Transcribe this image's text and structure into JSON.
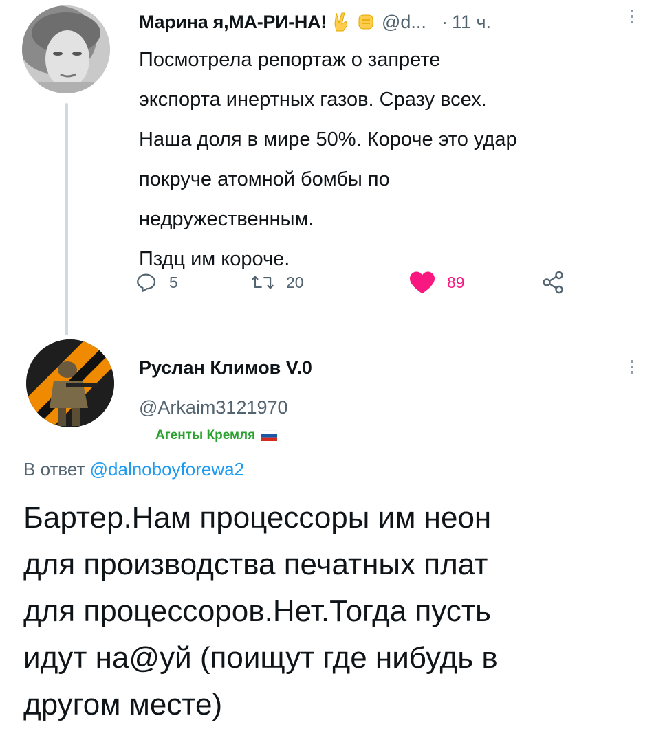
{
  "tweet1": {
    "author_name": "Марина я,МА-РИ-НА!",
    "emoji1": "victory-hand-emoji",
    "emoji2": "raised-fist-emoji",
    "handle": "@d...",
    "separator": "·",
    "time": "11 ч.",
    "body_lines": [
      "Посмотрела репортаж о запрете",
      "экспорта инертных газов. Сразу всех.",
      "Наша доля в мире 50%. Короче это удар",
      "покруче атомной бомбы по",
      "недружественным.",
      "Пздц им короче."
    ],
    "actions": {
      "reply_count": "5",
      "retweet_count": "20",
      "like_count": "89"
    },
    "liked": true
  },
  "tweet2": {
    "author_name": "Руслан Климов V.0",
    "handle": "@Arkaim3121970",
    "label": "Агенты Кремля",
    "reply_prefix": "В ответ",
    "reply_mention": "@dalnoboyforewa2",
    "body_lines": [
      "Бартер.Нам процессоры им неон",
      "для производства печатных плат",
      "для процессоров.Нет.Тогда пусть",
      "идут на@уй (поищут где нибудь в",
      "другом месте)"
    ]
  },
  "colors": {
    "text": "#0f1419",
    "secondary": "#536471",
    "like": "#f91880",
    "link": "#1d9bf0",
    "label_green": "#2aa12f",
    "thread_line": "#cfd9de"
  }
}
